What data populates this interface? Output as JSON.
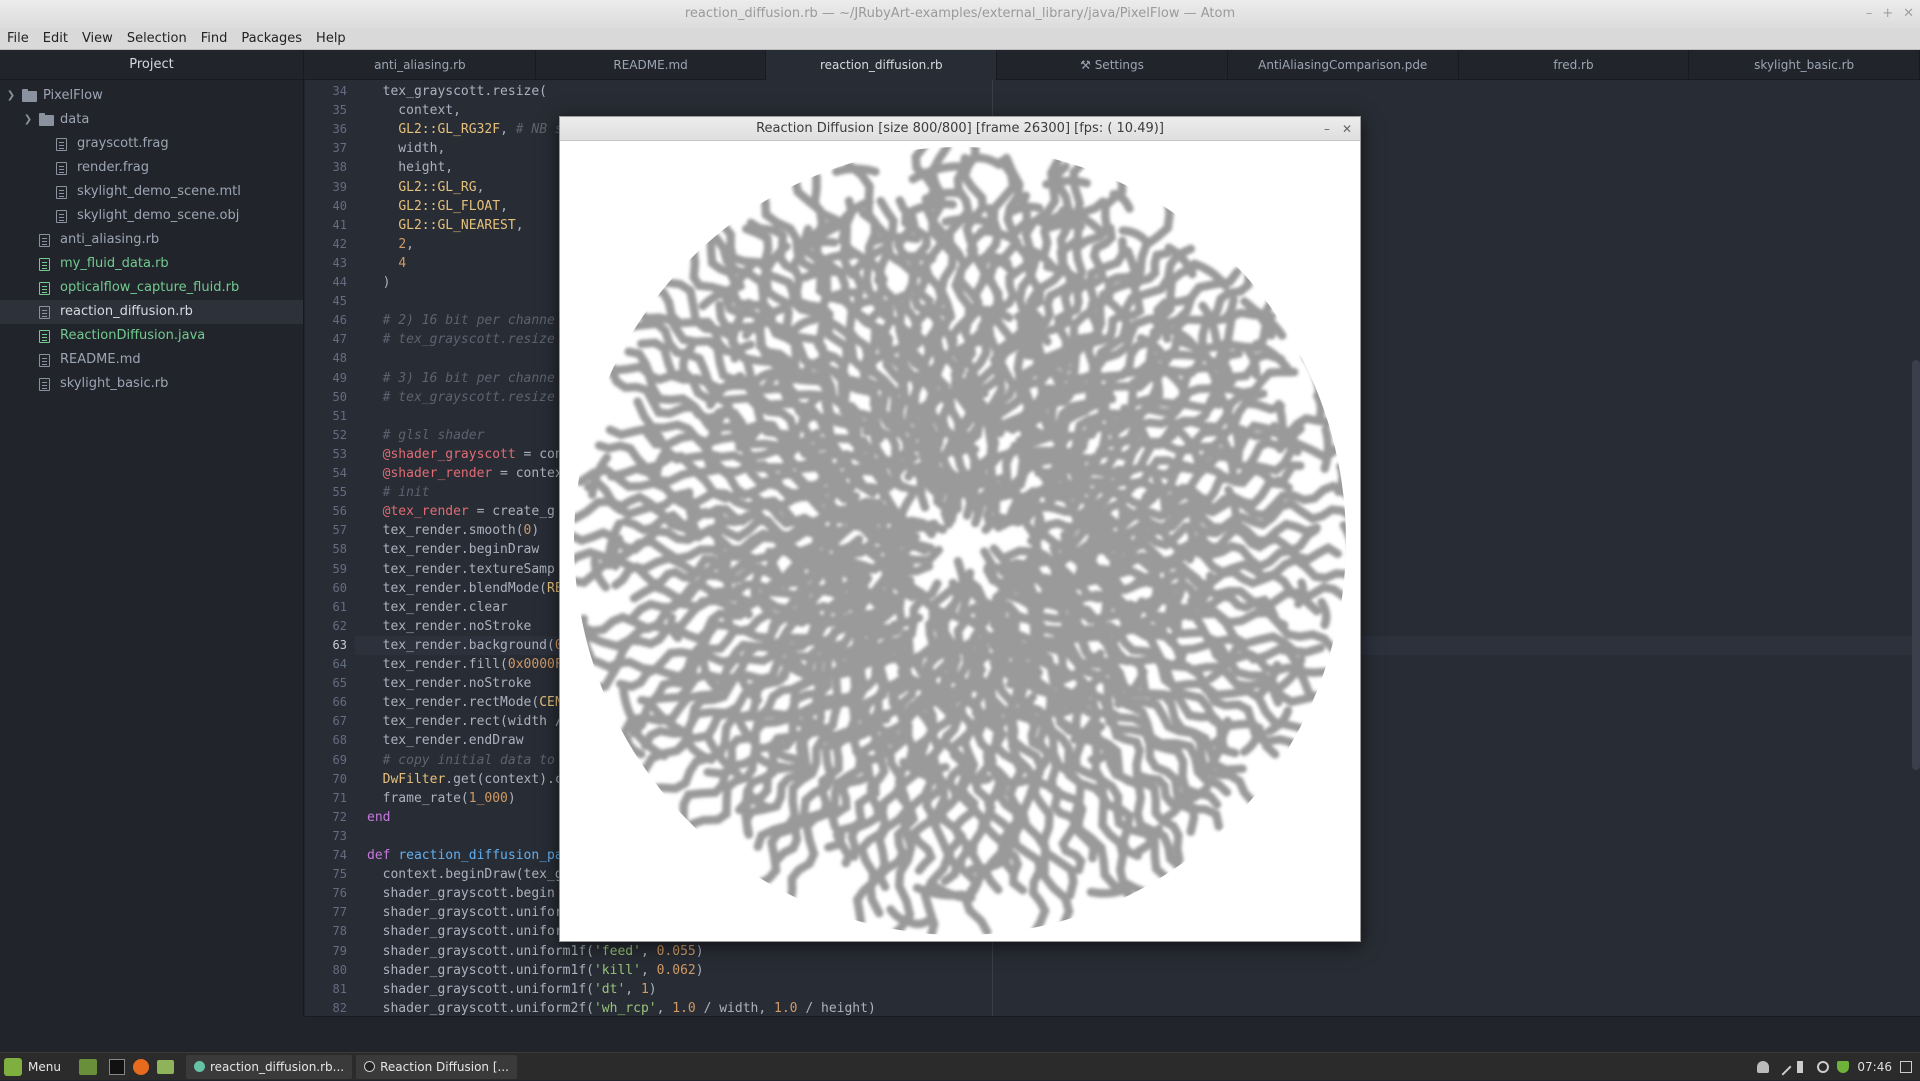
{
  "window": {
    "title": "reaction_diffusion.rb — ~/JRubyArt-examples/external_library/java/PixelFlow — Atom",
    "controls": [
      "–",
      "+",
      "✕"
    ]
  },
  "menu": [
    "File",
    "Edit",
    "View",
    "Selection",
    "Find",
    "Packages",
    "Help"
  ],
  "sidebar": {
    "title": "Project",
    "root": "PixelFlow",
    "folder": "data",
    "folder_files": [
      "grayscott.frag",
      "render.frag",
      "skylight_demo_scene.mtl",
      "skylight_demo_scene.obj"
    ],
    "files": [
      {
        "name": "anti_aliasing.rb",
        "status": "normal"
      },
      {
        "name": "my_fluid_data.rb",
        "status": "new"
      },
      {
        "name": "opticalflow_capture_fluid.rb",
        "status": "new"
      },
      {
        "name": "reaction_diffusion.rb",
        "status": "selected"
      },
      {
        "name": "ReactionDiffusion.java",
        "status": "new"
      },
      {
        "name": "README.md",
        "status": "normal"
      },
      {
        "name": "skylight_basic.rb",
        "status": "normal"
      }
    ]
  },
  "tabs": [
    "anti_aliasing.rb",
    "README.md",
    "reaction_diffusion.rb",
    "Settings",
    "AntiAliasingComparison.pde",
    "fred.rb",
    "skylight_basic.rb"
  ],
  "active_tab": "reaction_diffusion.rb",
  "editor": {
    "cursor_line": 63,
    "lines": [
      {
        "n": "34",
        "t": "  tex_grayscott.resize("
      },
      {
        "n": "35",
        "t": "    context,"
      },
      {
        "n": "36",
        "t": "    GL2::GL_RG32F, # NB s"
      },
      {
        "n": "37",
        "t": "    width,"
      },
      {
        "n": "38",
        "t": "    height,"
      },
      {
        "n": "39",
        "t": "    GL2::GL_RG,"
      },
      {
        "n": "40",
        "t": "    GL2::GL_FLOAT,"
      },
      {
        "n": "41",
        "t": "    GL2::GL_NEAREST,"
      },
      {
        "n": "42",
        "t": "    2,"
      },
      {
        "n": "43",
        "t": "    4"
      },
      {
        "n": "44",
        "t": "  )"
      },
      {
        "n": "45",
        "t": ""
      },
      {
        "n": "46",
        "t": "  # 2) 16 bit per channe"
      },
      {
        "n": "47",
        "t": "  # tex_grayscott.resize"
      },
      {
        "n": "48",
        "t": ""
      },
      {
        "n": "49",
        "t": "  # 3) 16 bit per channe"
      },
      {
        "n": "50",
        "t": "  # tex_grayscott.resize"
      },
      {
        "n": "51",
        "t": ""
      },
      {
        "n": "52",
        "t": "  # glsl shader"
      },
      {
        "n": "53",
        "t": "  @shader_grayscott = con"
      },
      {
        "n": "54",
        "t": "  @shader_render = contex"
      },
      {
        "n": "55",
        "t": "  # init"
      },
      {
        "n": "56",
        "t": "  @tex_render = create_g"
      },
      {
        "n": "57",
        "t": "  tex_render.smooth(0)"
      },
      {
        "n": "58",
        "t": "  tex_render.beginDraw"
      },
      {
        "n": "59",
        "t": "  tex_render.textureSamp"
      },
      {
        "n": "60",
        "t": "  tex_render.blendMode(RE"
      },
      {
        "n": "61",
        "t": "  tex_render.clear"
      },
      {
        "n": "62",
        "t": "  tex_render.noStroke"
      },
      {
        "n": "63",
        "t": "  tex_render.background(0"
      },
      {
        "n": "64",
        "t": "  tex_render.fill(0x0000F"
      },
      {
        "n": "65",
        "t": "  tex_render.noStroke"
      },
      {
        "n": "66",
        "t": "  tex_render.rectMode(CEN"
      },
      {
        "n": "67",
        "t": "  tex_render.rect(width /"
      },
      {
        "n": "68",
        "t": "  tex_render.endDraw"
      },
      {
        "n": "69",
        "t": "  # copy initial data to"
      },
      {
        "n": "70",
        "t": "  DwFilter.get(context).c"
      },
      {
        "n": "71",
        "t": "  frame_rate(1_000)"
      },
      {
        "n": "72",
        "t": "end"
      },
      {
        "n": "73",
        "t": ""
      },
      {
        "n": "74",
        "t": "def reaction_diffusion_pa"
      },
      {
        "n": "75",
        "t": "  context.beginDraw(tex_g"
      },
      {
        "n": "76",
        "t": "  shader_grayscott.begin"
      },
      {
        "n": "77",
        "t": "  shader_grayscott.unifor"
      },
      {
        "n": "78",
        "t": "  shader_grayscott.unifor"
      },
      {
        "n": "79",
        "t": "  shader_grayscott.uniform1f('feed', 0.055)"
      },
      {
        "n": "80",
        "t": "  shader_grayscott.uniform1f('kill', 0.062)"
      },
      {
        "n": "81",
        "t": "  shader_grayscott.uniform1f('dt', 1)"
      },
      {
        "n": "82",
        "t": "  shader_grayscott.uniform2f('wh_rcp', 1.0 / width, 1.0 / height)"
      }
    ]
  },
  "sketch": {
    "title": "Reaction Diffusion  [size 800/800]  [frame 26300]  [fps: ( 10.49)]",
    "controls": [
      "–",
      "✕"
    ],
    "pattern_color": "#9a9a9a",
    "background": "#ffffff"
  },
  "taskbar": {
    "menu_label": "Menu",
    "tasks": [
      "reaction_diffusion.rb...",
      "Reaction Diffusion  [..."
    ],
    "clock": "07:46"
  },
  "colors": {
    "editor_bg": "#282c34",
    "sidebar_bg": "#21252b",
    "new_file": "#73c990",
    "keyword": "#c678dd",
    "constant": "#e5c07b",
    "number": "#d19a66",
    "comment": "#5c6370",
    "ivar": "#e06c75",
    "function": "#61afef",
    "string": "#98c379"
  }
}
